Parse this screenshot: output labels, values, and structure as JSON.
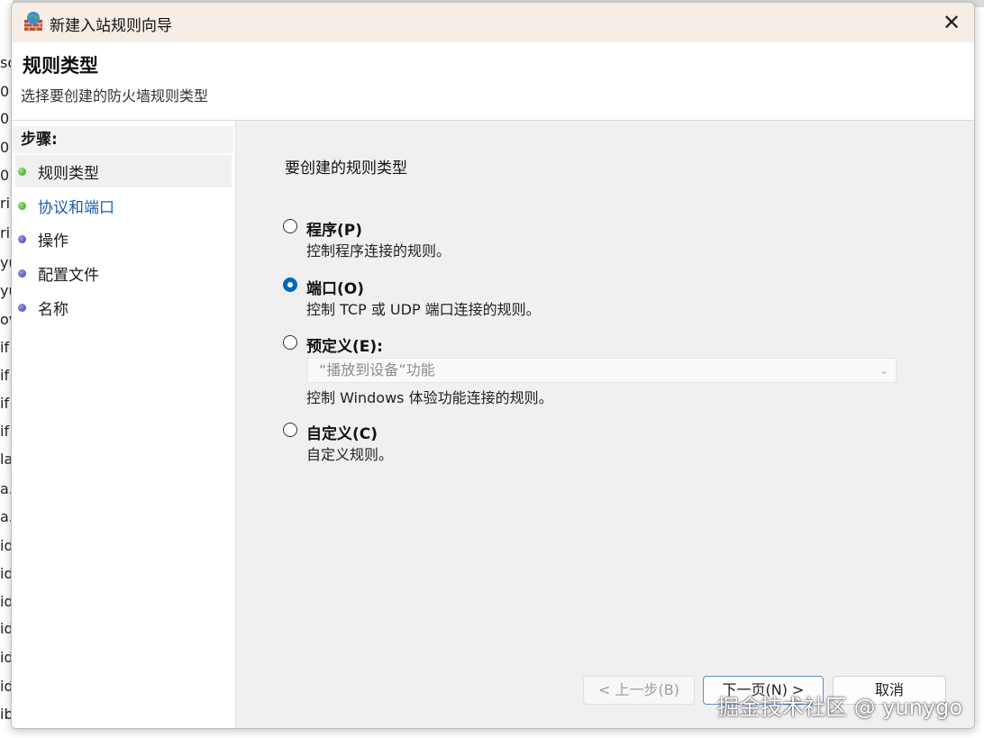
{
  "background": {
    "left_chars": [
      "so",
      "0",
      "0",
      "0:",
      "0:",
      "ri",
      "ri",
      "yu",
      "yu",
      "ov",
      "if",
      "if",
      "if",
      "if",
      "la",
      "a.",
      "a.",
      "id",
      "id",
      "id",
      "id",
      "id",
      "id",
      "ib"
    ]
  },
  "window": {
    "title": "新建入站规则向导",
    "close_symbol": "✕"
  },
  "header": {
    "title": "规则类型",
    "subtitle": "选择要创建的防火墙规则类型"
  },
  "sidebar": {
    "steps_label": "步骤:",
    "steps": [
      {
        "label": "规则类型",
        "dot": "green"
      },
      {
        "label": "协议和端口",
        "dot": "green"
      },
      {
        "label": "操作",
        "dot": "blue"
      },
      {
        "label": "配置文件",
        "dot": "blue"
      },
      {
        "label": "名称",
        "dot": "blue"
      }
    ]
  },
  "main": {
    "section_title": "要创建的规则类型",
    "options": [
      {
        "label": "程序(P)",
        "desc": "控制程序连接的规则。",
        "checked": false
      },
      {
        "label": "端口(O)",
        "desc": "控制 TCP 或 UDP 端口连接的规则。",
        "checked": true
      },
      {
        "label": "预定义(E):",
        "desc": "控制 Windows 体验功能连接的规则。",
        "checked": false
      },
      {
        "label": "自定义(C)",
        "desc": "自定义规则。",
        "checked": false
      }
    ],
    "predefined_value": "“播放到设备”功能"
  },
  "buttons": {
    "back": "< 上一步(B)",
    "next": "下一页(N) >",
    "cancel": "取消"
  },
  "watermark": "掘金技术社区 @ yunygo",
  "colors": {
    "titlebar": "#f6eee6",
    "accent": "#0067c0",
    "link": "#1a5ea8"
  }
}
